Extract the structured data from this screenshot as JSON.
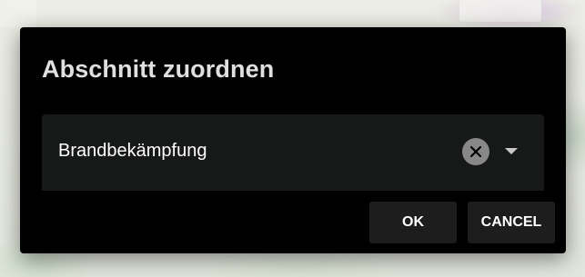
{
  "dialog": {
    "title": "Abschnitt zuordnen",
    "select": {
      "value": "Brandbekämpfung",
      "clear_icon": "close-circle-icon",
      "dropdown_icon": "caret-down-icon"
    },
    "ok_label": "OK",
    "cancel_label": "CANCEL"
  },
  "colors": {
    "dialog_bg": "#000000",
    "field_bg": "#171818",
    "button_bg": "#1d1d1d",
    "text": "#ffffff"
  }
}
